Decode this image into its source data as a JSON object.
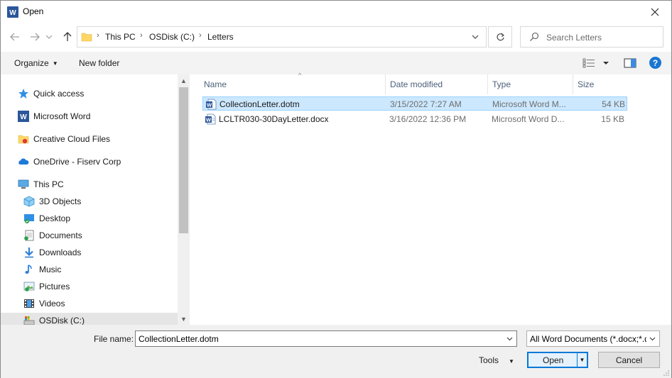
{
  "window": {
    "title": "Open",
    "app_icon": "word-icon"
  },
  "nav": {
    "back_icon": "arrow-left-icon",
    "forward_icon": "arrow-right-icon",
    "recent_icon": "chevron-down-icon",
    "up_icon": "arrow-up-icon",
    "breadcrumb": [
      "This PC",
      "OSDisk (C:)",
      "Letters"
    ],
    "search_placeholder": "Search Letters"
  },
  "toolbar": {
    "organize_label": "Organize",
    "new_folder_label": "New folder"
  },
  "sidebar": {
    "items": [
      {
        "label": "Quick access",
        "icon": "star-icon",
        "indent": 0
      },
      {
        "label": "Microsoft Word",
        "icon": "word-icon",
        "indent": 0
      },
      {
        "label": "Creative Cloud Files",
        "icon": "creative-cloud-icon",
        "indent": 0
      },
      {
        "label": "OneDrive - Fiserv Corp",
        "icon": "cloud-icon",
        "indent": 0
      },
      {
        "label": "This PC",
        "icon": "computer-icon",
        "indent": 0
      },
      {
        "label": "3D Objects",
        "icon": "cube-icon",
        "indent": 1
      },
      {
        "label": "Desktop",
        "icon": "desktop-icon",
        "indent": 1
      },
      {
        "label": "Documents",
        "icon": "documents-icon",
        "indent": 1
      },
      {
        "label": "Downloads",
        "icon": "download-icon",
        "indent": 1
      },
      {
        "label": "Music",
        "icon": "music-icon",
        "indent": 1
      },
      {
        "label": "Pictures",
        "icon": "pictures-icon",
        "indent": 1
      },
      {
        "label": "Videos",
        "icon": "video-icon",
        "indent": 1
      },
      {
        "label": "OSDisk (C:)",
        "icon": "drive-icon",
        "indent": 1,
        "selected": true
      }
    ]
  },
  "filelist": {
    "columns": [
      "Name",
      "Date modified",
      "Type",
      "Size"
    ],
    "rows": [
      {
        "name": "CollectionLetter.dotm",
        "date": "3/15/2022 7:27 AM",
        "type": "Microsoft Word M...",
        "size": "54 KB",
        "selected": true
      },
      {
        "name": "LCLTR030-30DayLetter.docx",
        "date": "3/16/2022 12:36 PM",
        "type": "Microsoft Word D...",
        "size": "15 KB",
        "selected": false
      }
    ]
  },
  "bottom": {
    "file_name_label": "File name:",
    "file_name_value": "CollectionLetter.dotm",
    "filter_value": "All Word Documents (*.docx;*.d",
    "tools_label": "Tools",
    "open_label": "Open",
    "cancel_label": "Cancel"
  },
  "colors": {
    "accent": "#0078d7",
    "selection": "#cce8ff",
    "word_blue": "#2b579a"
  }
}
